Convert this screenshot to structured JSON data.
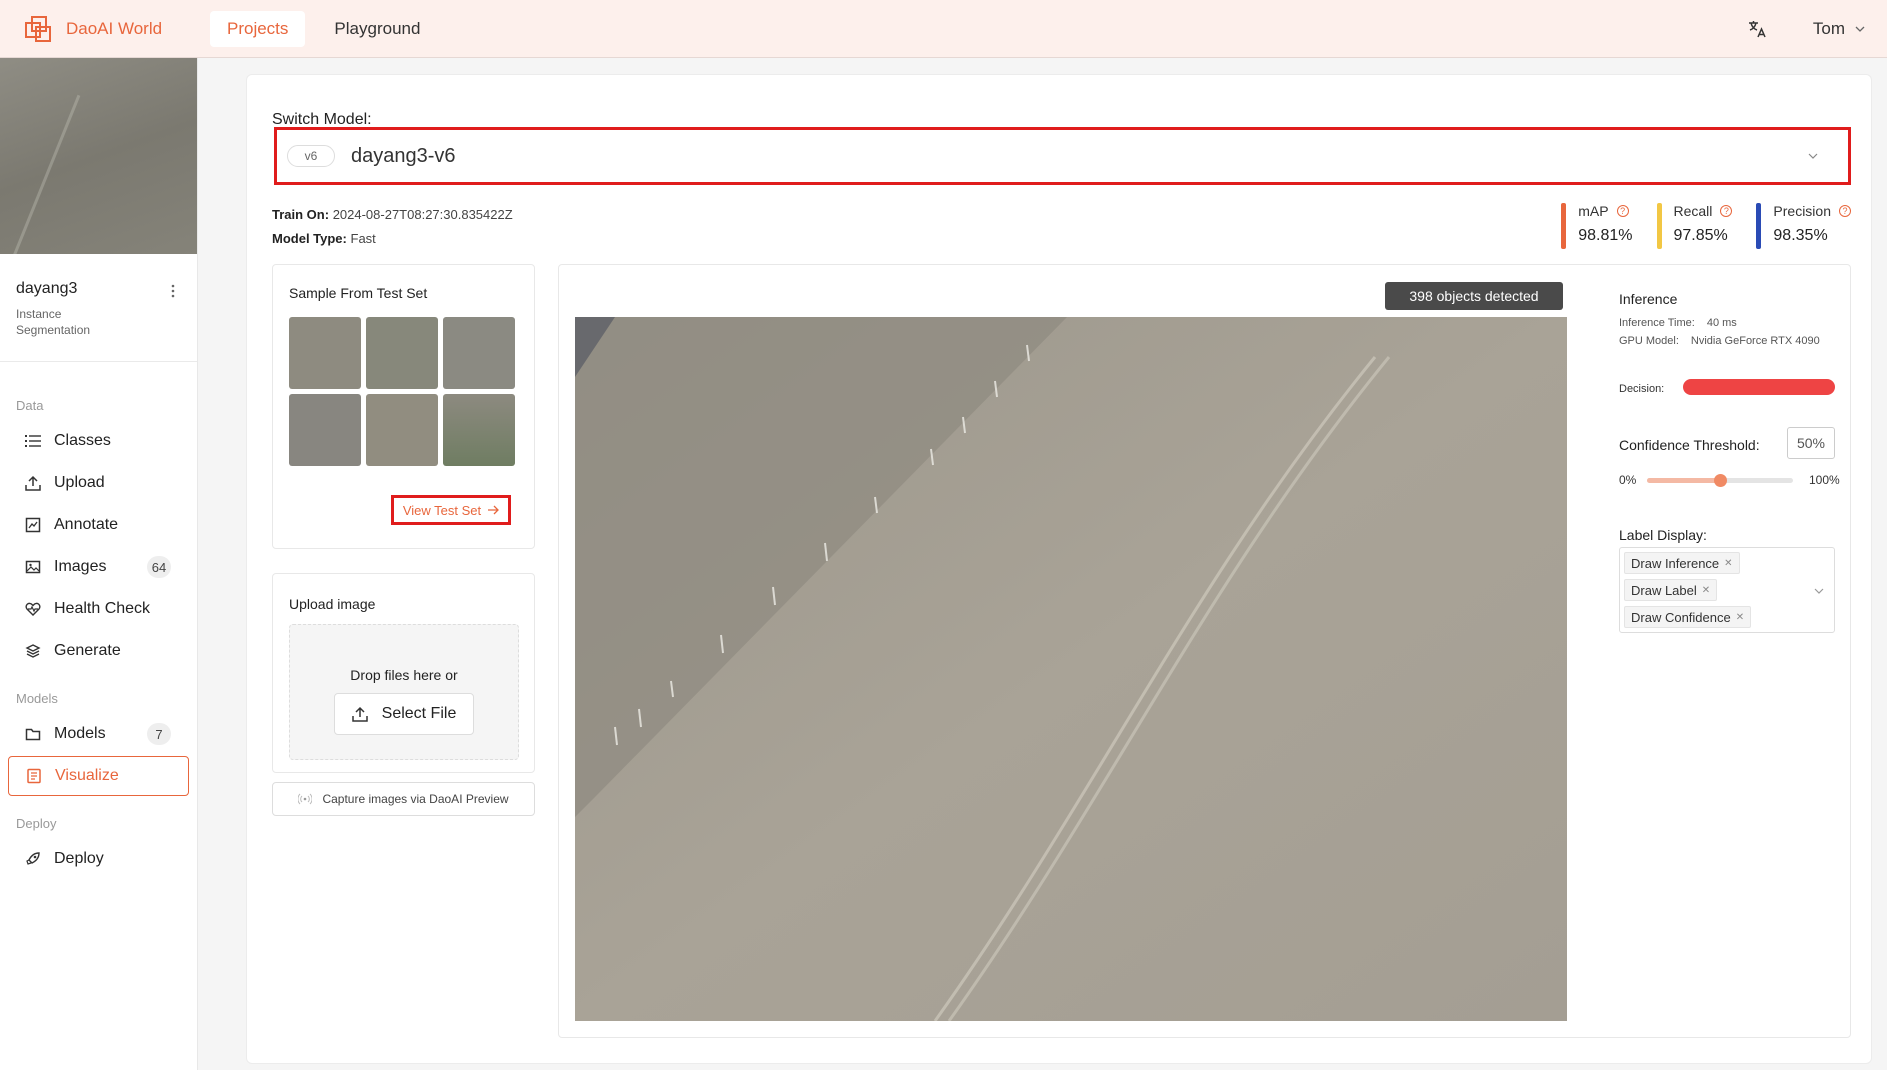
{
  "header": {
    "brand": "DaoAI World",
    "tabs": [
      {
        "label": "Projects",
        "active": true
      },
      {
        "label": "Playground",
        "active": false
      }
    ],
    "user": "Tom",
    "accent": "#e8663c"
  },
  "sidebar": {
    "project_name": "dayang3",
    "project_type": "Instance Segmentation",
    "sections": {
      "data": "Data",
      "models": "Models",
      "deploy": "Deploy"
    },
    "items": {
      "classes": "Classes",
      "upload": "Upload",
      "annotate": "Annotate",
      "images": "Images",
      "images_count": "64",
      "health_check": "Health Check",
      "generate": "Generate",
      "models": "Models",
      "models_count": "7",
      "visualize": "Visualize",
      "deploy": "Deploy"
    }
  },
  "model": {
    "switch_label": "Switch Model:",
    "version_tag": "v6",
    "name": "dayang3-v6",
    "train_on_label": "Train On:",
    "train_on": "2024-08-27T08:27:30.835422Z",
    "model_type_label": "Model Type:",
    "model_type": "Fast"
  },
  "metrics": [
    {
      "name": "mAP",
      "value": "98.81%",
      "color": "#e8663c"
    },
    {
      "name": "Recall",
      "value": "97.85%",
      "color": "#f2c744"
    },
    {
      "name": "Precision",
      "value": "98.35%",
      "color": "#2a4bb5"
    }
  ],
  "sample_panel": {
    "title": "Sample From Test Set",
    "view_button": "View Test Set",
    "sample_colors": [
      "#8e8b80",
      "#87887b",
      "#8b8a82",
      "#888680",
      "#918d80",
      "#7d8670"
    ]
  },
  "upload_panel": {
    "title": "Upload image",
    "drop_text": "Drop files here or",
    "select_button": "Select File",
    "capture_button": "Capture images via DaoAI Preview"
  },
  "viewer": {
    "detected": "398 objects detected"
  },
  "inference": {
    "title": "Inference",
    "time_label": "Inference Time:",
    "time_value": "40 ms",
    "gpu_label": "GPU Model:",
    "gpu_value": "Nvidia GeForce RTX 4090",
    "decision_label": "Decision:",
    "decision_color": "#ee4444",
    "confidence_label": "Confidence Threshold:",
    "confidence_value": "50%",
    "confidence_fraction": 0.5,
    "slider_min": "0%",
    "slider_max": "100%",
    "label_display_title": "Label Display:",
    "label_tags": [
      "Draw Inference",
      "Draw Label",
      "Draw Confidence"
    ]
  }
}
